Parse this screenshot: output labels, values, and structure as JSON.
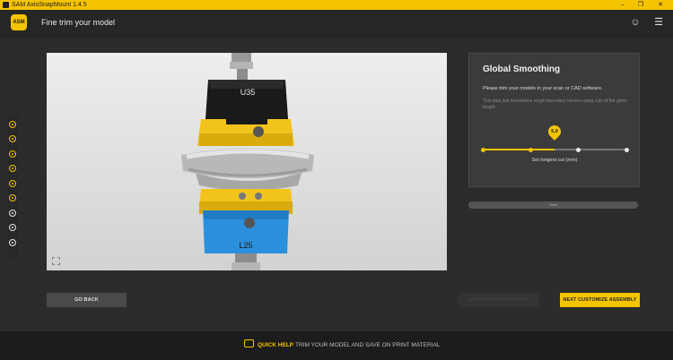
{
  "titlebar": {
    "title": "SAM AxioSnapMount 1.4.5",
    "min": "–",
    "max": "❐",
    "close": "✕"
  },
  "header": {
    "logo": "ASM",
    "page_title": "Fine trim your model",
    "user_icon": "☺",
    "menu_icon": "☰"
  },
  "steps": [
    {
      "state": "done"
    },
    {
      "state": "done"
    },
    {
      "state": "done"
    },
    {
      "state": "done"
    },
    {
      "state": "done"
    },
    {
      "state": "done"
    },
    {
      "state": "pending"
    },
    {
      "state": "pending"
    },
    {
      "state": "pending"
    }
  ],
  "viewer": {
    "upper_label": "U35",
    "lower_label": "L25"
  },
  "panel": {
    "title": "Global Smoothing",
    "instruction": "Please trim your models in your scan or CAD software.",
    "description": "This step just smoothens rough boundary corners using cuts of the given length.",
    "slider_value": "5,0",
    "slider_label": "Set longest cut (mm)",
    "slider_fraction": 0.5,
    "tick_count": 4
  },
  "bar_button": {
    "label": "Undo"
  },
  "buttons": {
    "go_back": "GO BACK",
    "suggest": "SUGGEST POSITIONING",
    "next": "NEXT CUSTOMIZE ASSEMBLY"
  },
  "footer": {
    "label": "QUICK HELP",
    "text": "TRIM YOUR MODEL AND SAVE ON PRINT MATERIAL"
  },
  "colors": {
    "accent": "#f5c400",
    "bg": "#2c2c2c",
    "blue_base": "#2a8fdc"
  }
}
